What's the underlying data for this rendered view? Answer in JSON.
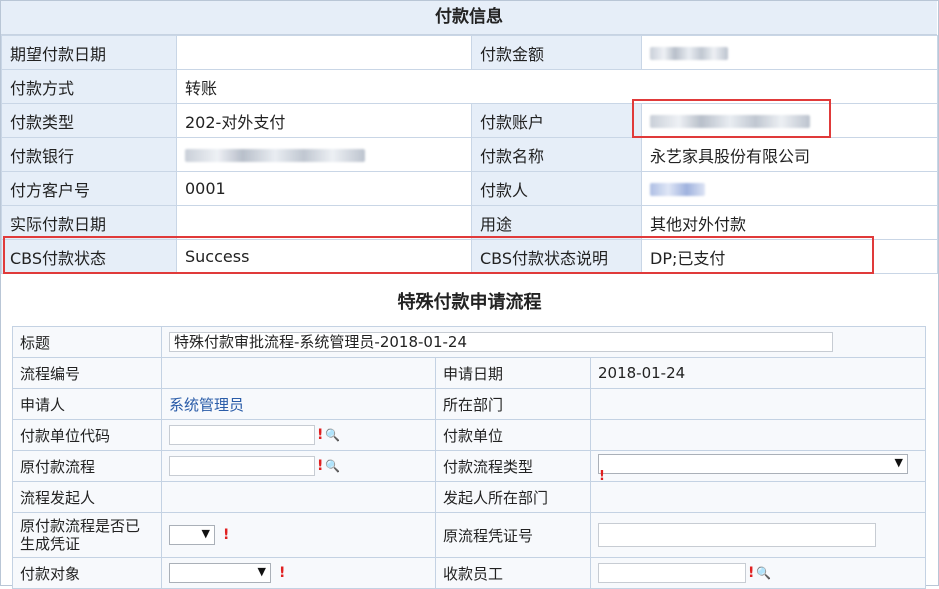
{
  "payment_info": {
    "title": "付款信息",
    "rows": [
      {
        "l1": "期望付款日期",
        "v1": "",
        "l2": "付款金额",
        "v2": ""
      },
      {
        "l1": "付款方式",
        "v1": "转账",
        "l2": "",
        "v2": ""
      },
      {
        "l1": "付款类型",
        "v1": "202-对外支付",
        "l2": "付款账户",
        "v2": ""
      },
      {
        "l1": "付款银行",
        "v1": "",
        "l2": "付款名称",
        "v2": "永艺家具股份有限公司"
      },
      {
        "l1": "付方客户号",
        "v1": "0001",
        "l2": "付款人",
        "v2": ""
      },
      {
        "l1": "实际付款日期",
        "v1": "",
        "l2": "用途",
        "v2": "其他对外付款"
      },
      {
        "l1": "CBS付款状态",
        "v1": "Success",
        "l2": "CBS付款状态说明",
        "v2": "DP;已支付"
      }
    ]
  },
  "special_flow": {
    "title": "特殊付款申请流程",
    "labels": {
      "title": "标题",
      "process_no": "流程编号",
      "apply_date": "申请日期",
      "applicant": "申请人",
      "department": "所在部门",
      "payer_unit_code": "付款单位代码",
      "payer_unit": "付款单位",
      "orig_process": "原付款流程",
      "process_type": "付款流程类型",
      "initiator": "流程发起人",
      "initiator_dept": "发起人所在部门",
      "voucher_generated": "原付款流程是否已生成凭证",
      "orig_voucher_no": "原流程凭证号",
      "pay_target": "付款对象",
      "payee_employee": "收款员工"
    },
    "values": {
      "title": "特殊付款审批流程-系统管理员-2018-01-24",
      "apply_date": "2018-01-24",
      "applicant": "系统管理员"
    }
  },
  "symbols": {
    "required": "!",
    "search": "🔍",
    "dropdown": "▼"
  }
}
